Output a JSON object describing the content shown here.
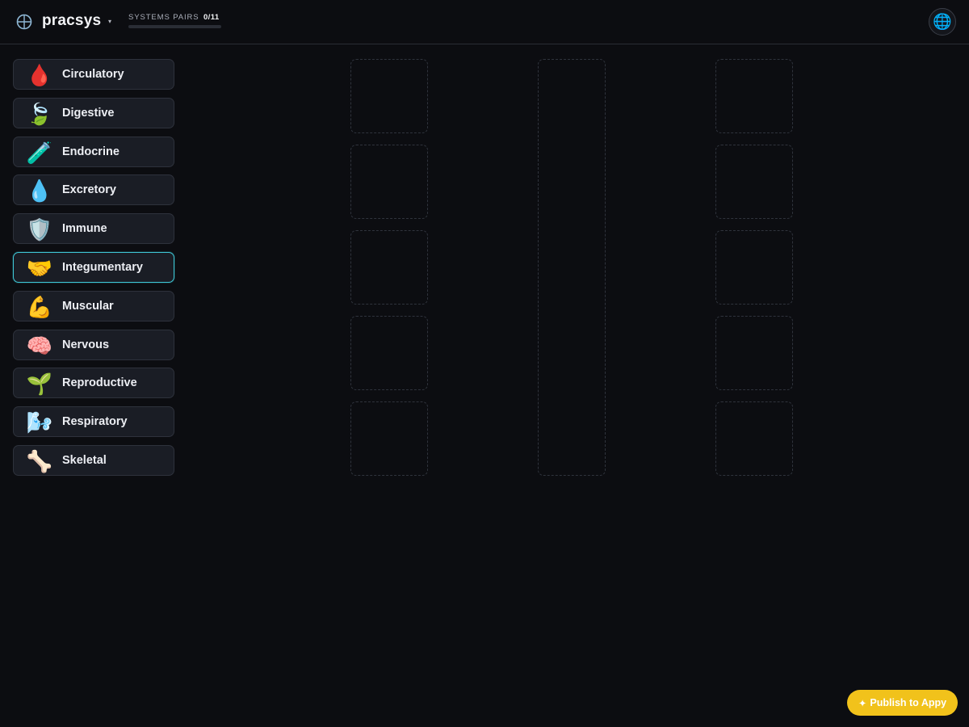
{
  "header": {
    "app_name": "pracsys",
    "caret_icon": "chevron-down-icon",
    "progress": {
      "label": "SYSTEMS PAIRS",
      "count": "0/11",
      "matched": 0,
      "total": 11
    },
    "globe_icon": "🌐"
  },
  "systems": [
    {
      "label": "Circulatory",
      "icon": "🩸"
    },
    {
      "label": "Digestive",
      "icon": "🍃"
    },
    {
      "label": "Endocrine",
      "icon": "🧪"
    },
    {
      "label": "Excretory",
      "icon": "💧"
    },
    {
      "label": "Immune",
      "icon": "🛡️"
    },
    {
      "label": "Integumentary",
      "icon": "🤝"
    },
    {
      "label": "Muscular",
      "icon": "💪"
    },
    {
      "label": "Nervous",
      "icon": "🧠"
    },
    {
      "label": "Reproductive",
      "icon": "🌱"
    },
    {
      "label": "Respiratory",
      "icon": "🌬️"
    },
    {
      "label": "Skeletal",
      "icon": "🦴"
    }
  ],
  "selected_system": "Integumentary",
  "publish": {
    "icon": "✦",
    "label": "Publish to Appy"
  },
  "colors": {
    "accent": "#3fc7d6",
    "publish": "#f1c21b",
    "background": "#0c0d11"
  }
}
